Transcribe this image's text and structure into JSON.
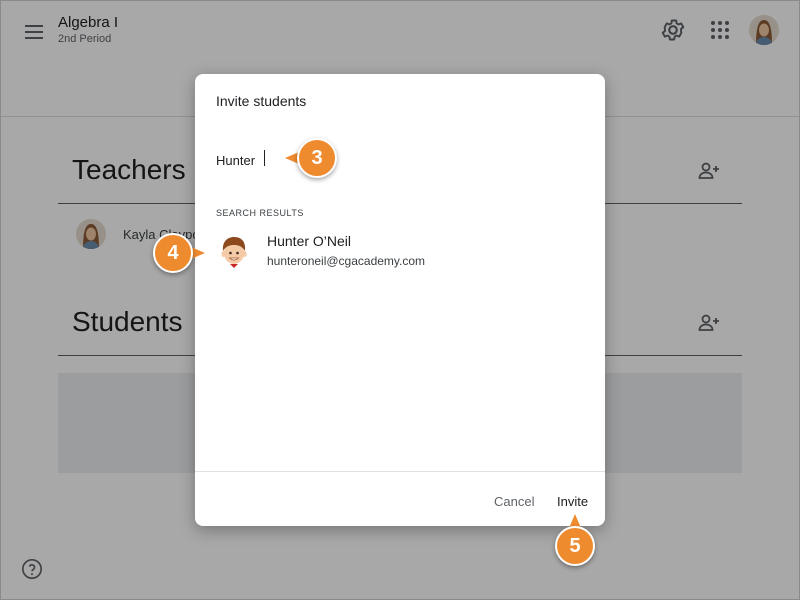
{
  "header": {
    "class_name": "Algebra I",
    "class_section": "2nd Period",
    "icons": [
      "menu-icon",
      "gear-icon",
      "apps-grid-icon",
      "avatar"
    ]
  },
  "people": {
    "teachers_title": "Teachers",
    "students_title": "Students",
    "teacher_name": "Kayla Claypo"
  },
  "dialog": {
    "title": "Invite students",
    "search_value": "Hunter",
    "results_label": "SEARCH RESULTS",
    "results": [
      {
        "name": "Hunter O’Neil",
        "email": "hunteroneil@cgacademy.com"
      }
    ],
    "cancel_label": "Cancel",
    "invite_label": "Invite"
  },
  "callouts": {
    "step_3": "3",
    "step_4": "4",
    "step_5": "5"
  },
  "colors": {
    "callout": "#ef8b2f",
    "overlay": "rgba(0,0,0,0.34)",
    "text_primary": "#202124",
    "text_secondary": "#5f6368"
  }
}
